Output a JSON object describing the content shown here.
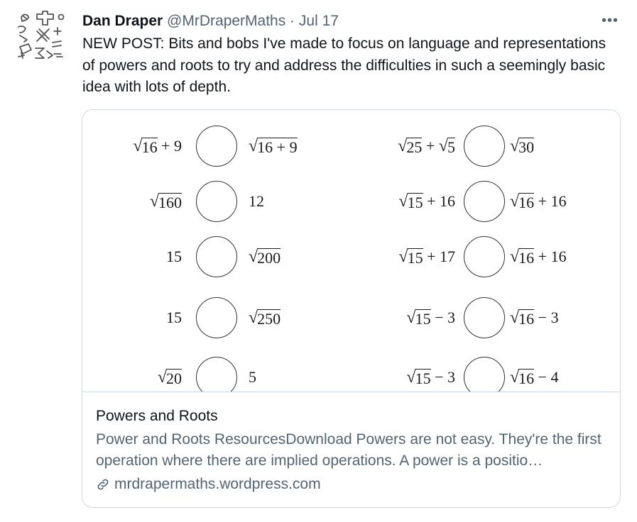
{
  "tweet": {
    "author_name": "Dan Draper",
    "author_meta": "@MrDraperMaths · Jul 17",
    "more_label": "•••",
    "text": "NEW POST: Bits and bobs I've made to focus on language and representations of powers and roots to try and address the difficulties in such a seemingly basic idea with lots of depth."
  },
  "card": {
    "title": "Powers and Roots",
    "description": "Power and Roots ResourcesDownload Powers are not easy. They're the first operation where there are implied operations. A power is a positio…",
    "domain": "mrdrapermaths.wordpress.com",
    "worksheet": {
      "left_column": [
        {
          "left": [
            {
              "root": "16"
            },
            {
              "text": " + 9"
            }
          ],
          "right": [
            {
              "root": "16 + 9"
            }
          ]
        },
        {
          "left": [
            {
              "root": "160"
            }
          ],
          "right": [
            {
              "text": "12"
            }
          ]
        },
        {
          "left": [
            {
              "text": "15"
            }
          ],
          "right": [
            {
              "root": "200"
            }
          ]
        },
        {
          "left": [
            {
              "text": "15"
            }
          ],
          "right": [
            {
              "root": "250"
            }
          ]
        },
        {
          "left": [
            {
              "root": "20"
            }
          ],
          "right": [
            {
              "text": "5"
            }
          ]
        }
      ],
      "right_column": [
        {
          "left": [
            {
              "root": "25"
            },
            {
              "text": " + "
            },
            {
              "root": "5"
            }
          ],
          "right": [
            {
              "root": "30"
            }
          ]
        },
        {
          "left": [
            {
              "root": "15"
            },
            {
              "text": " + 16"
            }
          ],
          "right": [
            {
              "root": "16"
            },
            {
              "text": " + 16"
            }
          ]
        },
        {
          "left": [
            {
              "root": "15"
            },
            {
              "text": " + 17"
            }
          ],
          "right": [
            {
              "root": "16"
            },
            {
              "text": " + 16"
            }
          ]
        },
        {
          "left": [
            {
              "root": "15"
            },
            {
              "text": " − 3"
            }
          ],
          "right": [
            {
              "root": "16"
            },
            {
              "text": " − 3"
            }
          ]
        },
        {
          "left": [
            {
              "root": "15"
            },
            {
              "text": " − 3"
            }
          ],
          "right": [
            {
              "root": "16"
            },
            {
              "text": " − 4"
            }
          ]
        }
      ]
    }
  }
}
